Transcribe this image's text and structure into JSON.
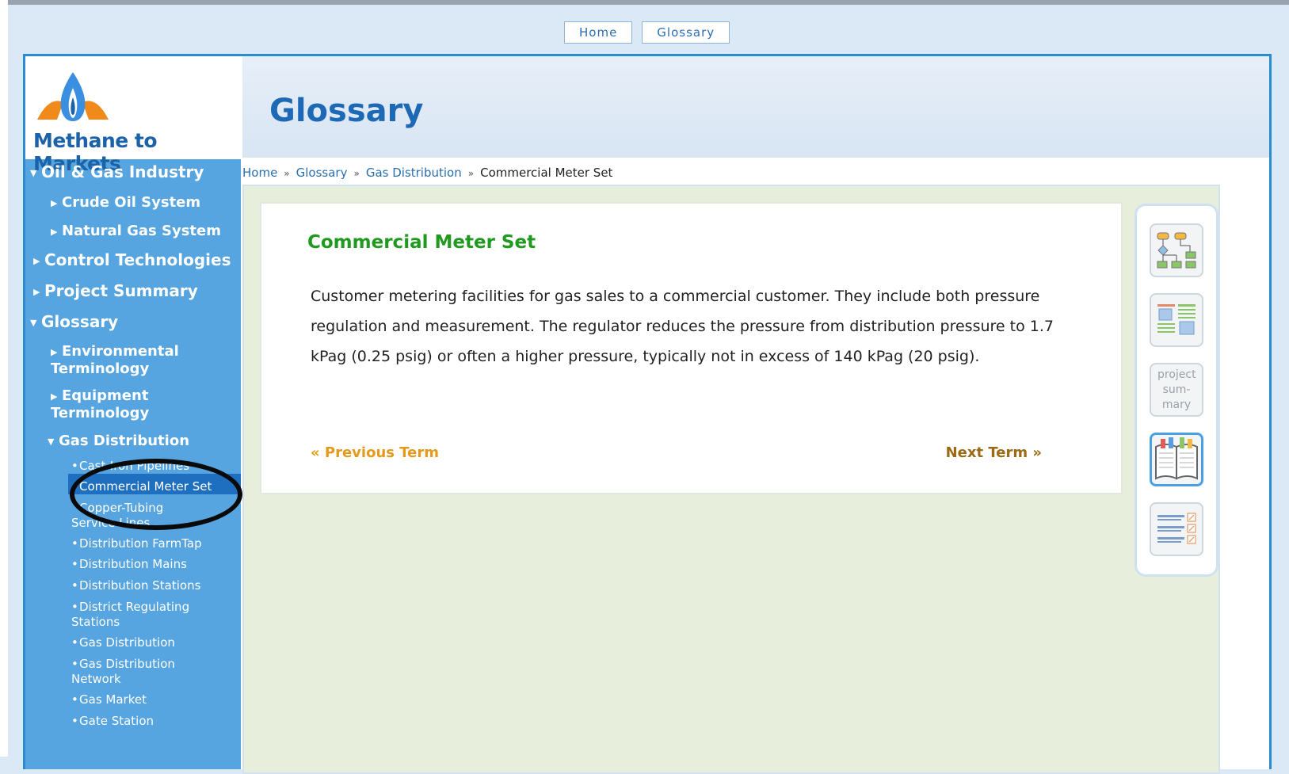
{
  "top_links": [
    "Home",
    "Glossary"
  ],
  "logo": {
    "text": "Methane to Markets"
  },
  "sidebar": {
    "items": [
      {
        "label": "Oil & Gas Industry",
        "level": 1,
        "expanded": true
      },
      {
        "label": "Crude Oil System",
        "level": 2
      },
      {
        "label": "Natural Gas System",
        "level": 2
      },
      {
        "label": "Control Technologies",
        "level": 1
      },
      {
        "label": "Project Summary",
        "level": 1
      },
      {
        "label": "Glossary",
        "level": 1,
        "expanded": true
      },
      {
        "label": "Environmental Terminology",
        "level": 2
      },
      {
        "label": "Equipment Terminology",
        "level": 2
      },
      {
        "label": "Gas Distribution",
        "level": 2,
        "expanded": true
      },
      {
        "label": "Cast-Iron Pipelines",
        "level": 3
      },
      {
        "label": "Commercial Meter Set",
        "level": 3,
        "selected": true
      },
      {
        "label": "Copper-Tubing Service Lines",
        "level": 3
      },
      {
        "label": "Distribution FarmTap",
        "level": 3
      },
      {
        "label": "Distribution Mains",
        "level": 3
      },
      {
        "label": "Distribution Stations",
        "level": 3
      },
      {
        "label": "District Regulating Stations",
        "level": 3
      },
      {
        "label": "Gas Distribution",
        "level": 3
      },
      {
        "label": "Gas Distribution Network",
        "level": 3
      },
      {
        "label": "Gas Market",
        "level": 3
      },
      {
        "label": "Gate Station",
        "level": 3
      }
    ]
  },
  "header": {
    "title": "Glossary"
  },
  "breadcrumb": [
    "Home",
    "Glossary",
    "Gas Distribution",
    "Commercial Meter Set"
  ],
  "term": {
    "title": "Commercial Meter Set",
    "definition": "Customer metering facilities for gas sales to a commercial customer. They include both pressure regulation and measurement. The regulator reduces the pressure from distribution pressure to 1.7 kPag (0.25 psig) or often a higher pressure, typically not in excess of 140 kPag (20 psig).",
    "prev_label": "« Previous Term",
    "next_label": "Next Term »"
  },
  "tools": [
    {
      "icon": "flowchart-icon"
    },
    {
      "icon": "layout-icon"
    },
    {
      "icon": "project-summary-icon",
      "label": "project sum- mary"
    },
    {
      "icon": "glossary-book-icon",
      "active": true
    },
    {
      "icon": "document-list-icon"
    }
  ],
  "colors": {
    "sidebar": "#56a4e0",
    "accent": "#1d69b5",
    "term_title": "#1f9a1f",
    "prev": "#e59a1b"
  }
}
